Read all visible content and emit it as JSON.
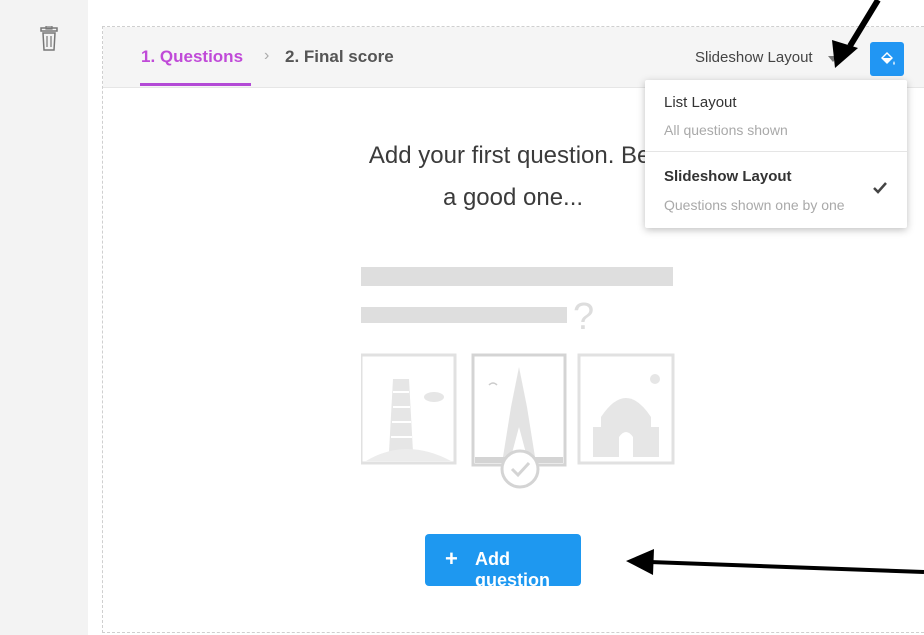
{
  "steps": {
    "step1": "1. Questions",
    "separator": "›",
    "step2": "2. Final score"
  },
  "layout_selector": {
    "label": "Slideshow Layout"
  },
  "dropdown": {
    "options": [
      {
        "title": "List Layout",
        "subtitle": "All questions shown"
      },
      {
        "title": "Slideshow Layout",
        "subtitle": "Questions shown one by one",
        "selected": true,
        "check": "✔"
      }
    ]
  },
  "main": {
    "prompt_line1": "Add your first question. Bet",
    "prompt_line2": "a good one...",
    "add_button": {
      "icon": "+",
      "label": "Add question"
    }
  },
  "colors": {
    "accent_purple": "#c04ad8",
    "button_blue": "#1e98f0",
    "theme_button": "#2196f3"
  },
  "icons": [
    "trash-icon",
    "paint-bucket-icon",
    "chevron-down-icon",
    "check-icon",
    "plus-icon"
  ]
}
